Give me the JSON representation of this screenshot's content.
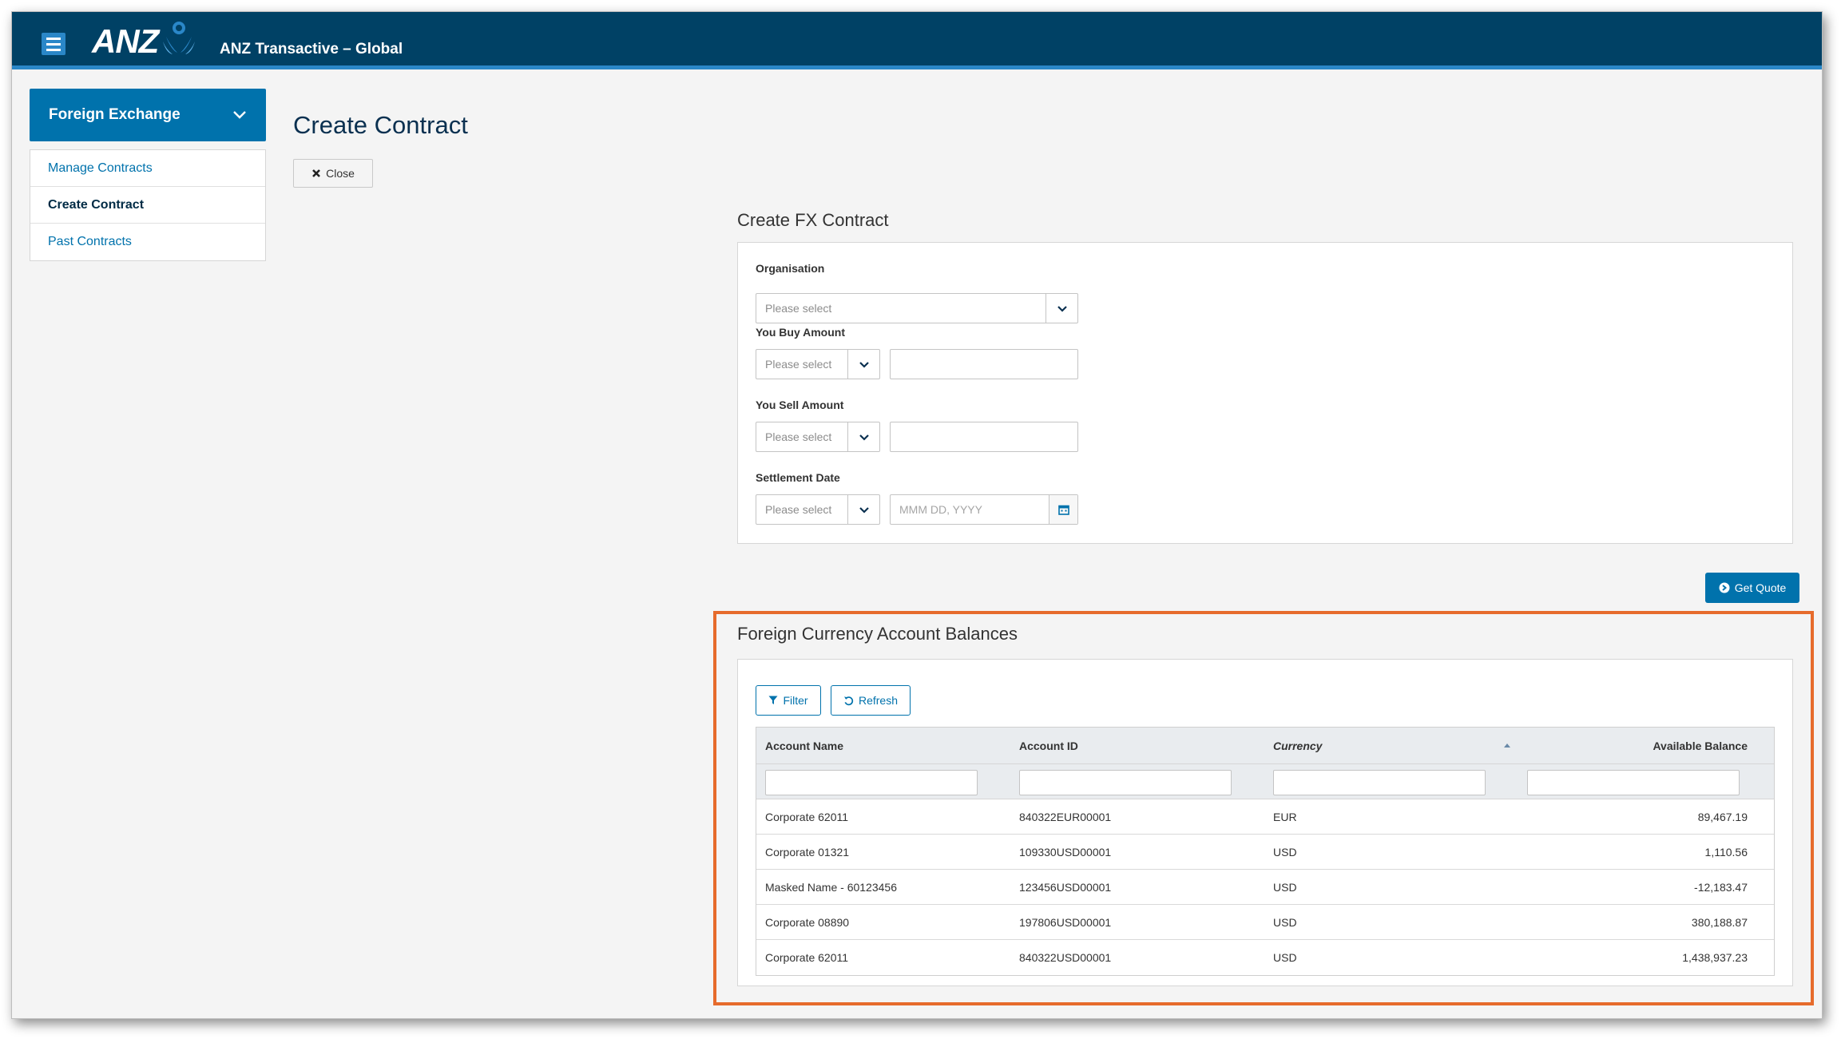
{
  "header": {
    "logo_text": "ANZ",
    "app_title": "ANZ Transactive – Global"
  },
  "sidebar": {
    "section_label": "Foreign Exchange",
    "items": [
      {
        "label": "Manage Contracts",
        "active": false
      },
      {
        "label": "Create Contract",
        "active": true
      },
      {
        "label": "Past Contracts",
        "active": false
      }
    ]
  },
  "page": {
    "title": "Create Contract",
    "close_label": "Close"
  },
  "fx_form": {
    "title": "Create FX Contract",
    "organisation_label": "Organisation",
    "organisation_value": "Please select",
    "buy_label": "You Buy Amount",
    "buy_currency": "Please select",
    "buy_amount": "",
    "sell_label": "You Sell Amount",
    "sell_currency": "Please select",
    "sell_amount": "",
    "settlement_label": "Settlement Date",
    "settlement_type": "Please select",
    "settlement_date_placeholder": "MMM DD, YYYY",
    "get_quote_label": "Get Quote"
  },
  "balances": {
    "title": "Foreign Currency Account Balances",
    "filter_label": "Filter",
    "refresh_label": "Refresh",
    "columns": [
      "Account Name",
      "Account ID",
      "Currency",
      "Available Balance"
    ],
    "sorted_column": "Currency",
    "rows": [
      {
        "name": "Corporate 62011",
        "id": "840322EUR00001",
        "currency": "EUR",
        "balance": "89,467.19"
      },
      {
        "name": "Corporate 01321",
        "id": "109330USD00001",
        "currency": "USD",
        "balance": "1,110.56"
      },
      {
        "name": "Masked Name - 60123456",
        "id": "123456USD00001",
        "currency": "USD",
        "balance": "-12,183.47"
      },
      {
        "name": "Corporate 08890",
        "id": "197806USD00001",
        "currency": "USD",
        "balance": "380,188.87"
      },
      {
        "name": "Corporate 62011",
        "id": "840322USD00001",
        "currency": "USD",
        "balance": "1,438,937.23"
      }
    ]
  },
  "colors": {
    "header_bg": "#004165",
    "primary": "#0072ac",
    "highlight": "#e66b2c"
  }
}
